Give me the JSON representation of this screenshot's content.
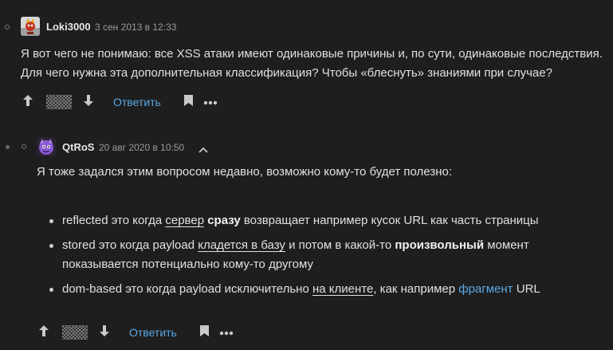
{
  "comments": [
    {
      "username": "Loki3000",
      "date": "3 сен 2013 в 12:33",
      "body_lines": [
        "Я вот чего не понимаю: все XSS атаки имеют одинаковые причины и, по сути, одинаковые последствия.",
        "Для чего нужна эта дополнительная классификация? Чтобы «блеснуть» знаниями при случае?"
      ],
      "reply_label": "Ответить"
    },
    {
      "username": "QtRoS",
      "date": "20 авг 2020 в 10:50",
      "intro": "Я тоже задался этим вопросом недавно, возможно кому-то будет полезно:",
      "items": [
        {
          "p1": "reflected это когда ",
          "u1": "сервер",
          "sp": " ",
          "b1": "сразу",
          "p2": " возвращает например кусок URL как часть страницы"
        },
        {
          "p1": "stored это когда payload ",
          "u1": "кладется в базу",
          "p2": " и потом в какой-то ",
          "b1": "произвольный",
          "p3": " момент",
          "line2": "показывается потенциально кому-то другому"
        },
        {
          "p1": "dom-based это когда payload исключительно ",
          "u1": "на клиенте",
          "p2": ", как например ",
          "link1": "фрагмент",
          "p3": " URL"
        }
      ],
      "reply_label": "Ответить"
    }
  ],
  "colors": {
    "background": "#1e1e1e",
    "link": "#5aa9e6",
    "text": "#e0e0e0"
  }
}
